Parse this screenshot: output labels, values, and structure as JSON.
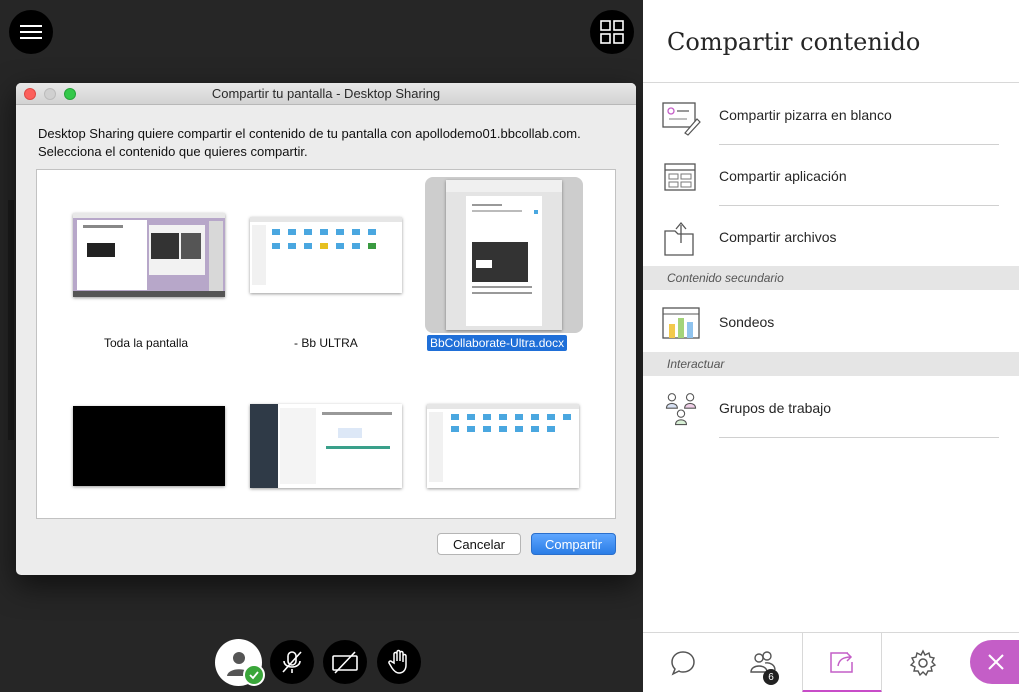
{
  "dialog": {
    "title": "Compartir tu pantalla - Desktop Sharing",
    "message_line1": "Desktop Sharing quiere compartir el contenido de tu pantalla con apollodemo01.bbcollab.com.",
    "message_line2": "Selecciona el contenido que quieres compartir.",
    "thumbnails": [
      {
        "label": "Toda la pantalla",
        "selected": false
      },
      {
        "label": "- Bb ULTRA",
        "selected": false
      },
      {
        "label": "BbCollaborate-Ultra.docx",
        "selected": true
      },
      {
        "label": "",
        "selected": false
      },
      {
        "label": "",
        "selected": false
      },
      {
        "label": "",
        "selected": false
      }
    ],
    "cancel_label": "Cancelar",
    "share_label": "Compartir"
  },
  "panel": {
    "title": "Compartir contenido",
    "options": [
      {
        "label": "Compartir pizarra en blanco",
        "icon": "whiteboard-icon"
      },
      {
        "label": "Compartir aplicación",
        "icon": "application-window-icon"
      },
      {
        "label": "Compartir archivos",
        "icon": "share-files-icon"
      }
    ],
    "section_secondary": "Contenido secundario",
    "polls_label": "Sondeos",
    "section_interact": "Interactuar",
    "groups_label": "Grupos de trabajo",
    "tabs": {
      "chat_icon": "chat-icon",
      "participants_icon": "participants-icon",
      "participants_count": "6",
      "share_icon": "share-content-icon",
      "settings_icon": "gear-icon",
      "close_icon": "close-icon"
    },
    "accent_color": "#c45ec7"
  },
  "controls": {
    "icons": [
      "menu-icon",
      "grid-layout-icon",
      "avatar-icon",
      "microphone-muted-icon",
      "camera-off-icon",
      "raise-hand-icon"
    ]
  }
}
